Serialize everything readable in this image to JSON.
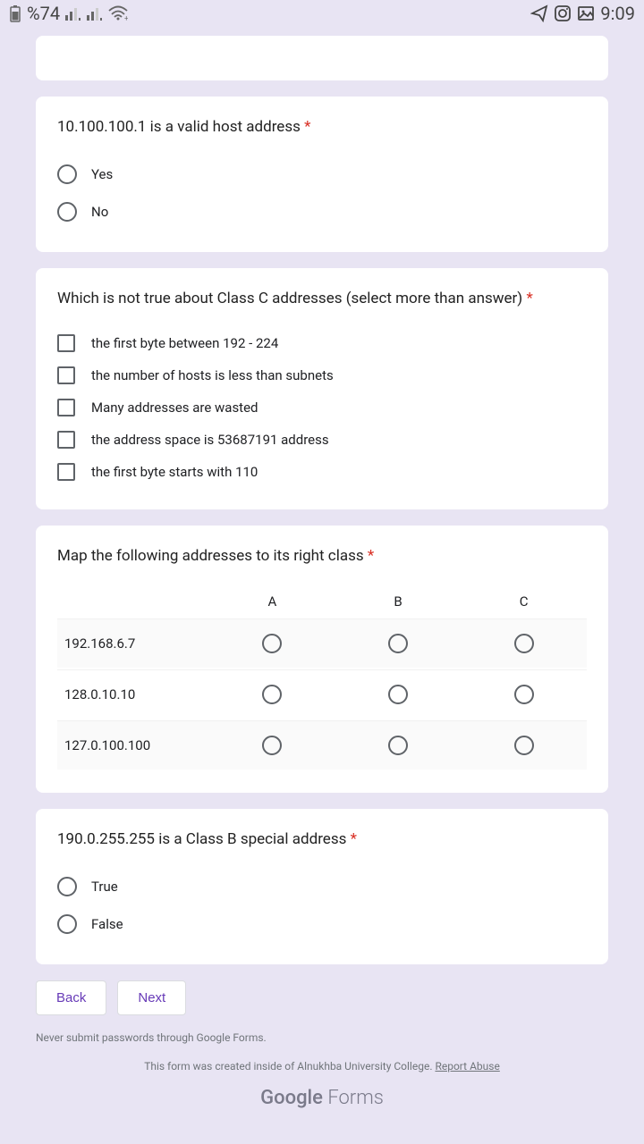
{
  "status_bar": {
    "battery_pct": "%74",
    "time": "9:09"
  },
  "q1": {
    "title": "10.100.100.1 is a valid host address",
    "opt_yes": "Yes",
    "opt_no": "No"
  },
  "q2": {
    "title": "Which is not true about Class C addresses (select more than answer)",
    "opts": [
      "the first byte between 192 - 224",
      "the number of hosts is less than subnets",
      "Many addresses are wasted",
      "the address space is 53687191 address",
      "the first byte starts with 110"
    ]
  },
  "q3": {
    "title": "Map the following addresses to its right class",
    "cols": [
      "A",
      "B",
      "C"
    ],
    "rows": [
      "192.168.6.7",
      "128.0.10.10",
      "127.0.100.100"
    ]
  },
  "q4": {
    "title": "190.0.255.255 is a Class B special address",
    "opt_true": "True",
    "opt_false": "False"
  },
  "nav": {
    "back": "Back",
    "next": "Next"
  },
  "footer": {
    "disclaimer": "Never submit passwords through Google Forms.",
    "attribution_pre": "This form was created inside of Alnukhba University College. ",
    "report": "Report Abuse",
    "brand_g": "Google",
    "brand_f": " Forms"
  }
}
